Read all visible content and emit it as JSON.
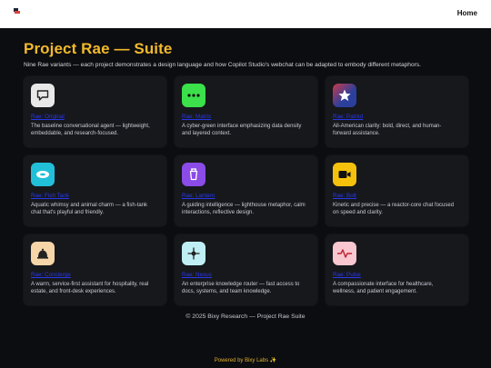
{
  "nav": {
    "home_label": "Home"
  },
  "hero": {
    "title": "Project Rae — Suite",
    "subtitle": "Nine Rae variants — each project demonstrates a design language and how Copilot Studio's webchat can be adapted to embody different metaphors."
  },
  "cards": [
    {
      "title": "Rae: Original",
      "desc": "The baseline conversational agent — lightweight, embeddable, and research-focused.",
      "icon": "chat-bubble-icon",
      "color": "#e6e6e6"
    },
    {
      "title": "Rae: Matrix",
      "desc": "A cyber-green interface emphasizing data density and layered context.",
      "icon": "dots-icon",
      "color": "#3be04a"
    },
    {
      "title": "Rae: Patriot",
      "desc": "All-American clarity: bold, direct, and human-forward assistance.",
      "icon": "star-icon",
      "color": "#2b3f9c"
    },
    {
      "title": "Rae: Fish Tank",
      "desc": "Aquatic whimsy and animal charm — a fish-tank chat that's playful and friendly.",
      "icon": "fish-icon",
      "color": "#22bfd8"
    },
    {
      "title": "Rae: Lantern",
      "desc": "A guiding intelligence — lighthouse metaphor, calm interactions, reflective design.",
      "icon": "lantern-icon",
      "color": "#8a4be6"
    },
    {
      "title": "Rae: Bolt",
      "desc": "Kinetic and precise — a reactor-core chat focused on speed and clarity.",
      "icon": "video-icon",
      "color": "#f4c20d"
    },
    {
      "title": "Rae: Concierge",
      "desc": "A warm, service-first assistant for hospitality, real estate, and front-desk experiences.",
      "icon": "bell-icon",
      "color": "#f6d5a8"
    },
    {
      "title": "Rae: Nexus",
      "desc": "An enterprise knowledge router — fast access to docs, systems, and team knowledge.",
      "icon": "crosshair-icon",
      "color": "#bfeff5"
    },
    {
      "title": "Rae: Pulse",
      "desc": "A compassionate interface for healthcare, wellness, and patient engagement.",
      "icon": "heartbeat-icon",
      "color": "#f8c7cf"
    }
  ],
  "footer": {
    "copyright": "© 2025 Bixy Research — Project Rae Suite",
    "powered": "Powered by Bixy Labs ✨"
  }
}
